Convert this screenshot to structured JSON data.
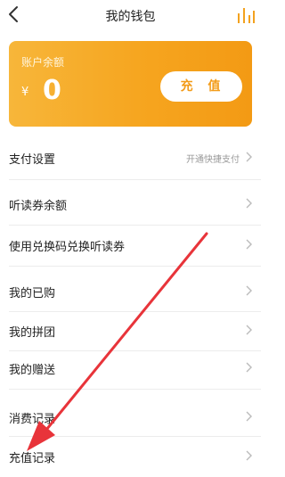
{
  "header": {
    "title": "我的钱包",
    "back_icon": "back-arrow-icon",
    "stats_icon": "bar-chart-icon"
  },
  "wallet": {
    "label": "账户余额",
    "currency": "¥",
    "balance": "0",
    "recharge_label": "充 值",
    "gradient_start": "#f7b63a",
    "gradient_end": "#f39a14"
  },
  "menu": {
    "items": [
      {
        "label": "支付设置",
        "hint": "开通快捷支付"
      },
      {
        "label": "听读券余额"
      },
      {
        "label": "使用兑换码兑换听读券"
      },
      {
        "label": "我的已购"
      },
      {
        "label": "我的拼团"
      },
      {
        "label": "我的赠送"
      },
      {
        "label": "消费记录"
      },
      {
        "label": "充值记录"
      }
    ]
  },
  "annotation": {
    "color": "#e8343a"
  }
}
